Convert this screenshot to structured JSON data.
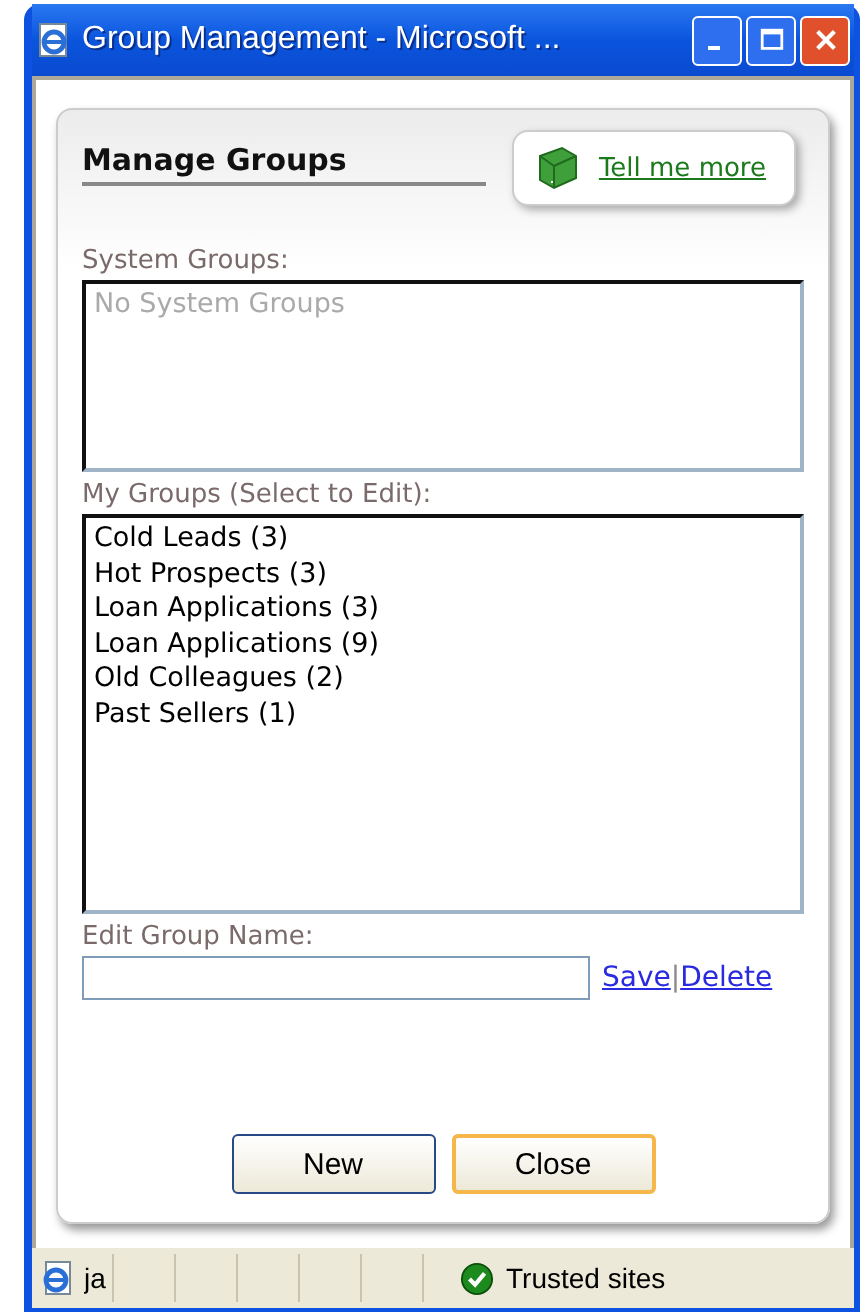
{
  "window": {
    "title": "Group Management - Microsoft ..."
  },
  "panel": {
    "title": "Manage Groups",
    "help_link": "Tell me more"
  },
  "system_groups": {
    "label": "System Groups:",
    "empty_text": "No System Groups"
  },
  "my_groups": {
    "label": "My Groups (Select to Edit):",
    "items": [
      {
        "label": "Cold Leads (3)",
        "selected": false
      },
      {
        "label": "Hot Prospects (3)",
        "selected": false
      },
      {
        "label": "Loan Applications (3)",
        "selected": false
      },
      {
        "label": "Loan Applications (9)",
        "selected": false
      },
      {
        "label": "Old Colleagues (2)",
        "selected": false
      },
      {
        "label": "Past Sellers (1)",
        "selected": false
      }
    ]
  },
  "edit": {
    "label": "Edit Group Name:",
    "links": [
      "Save",
      "Delete"
    ],
    "separator": "|"
  },
  "buttons": [
    {
      "label": "New",
      "focused": false
    },
    {
      "label": "Close",
      "focused": true
    }
  ],
  "status_bar": {
    "text": "ja",
    "zone": "Trusted sites"
  }
}
